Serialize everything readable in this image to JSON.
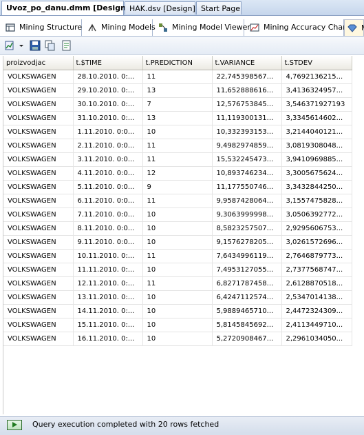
{
  "doc_tabs": [
    {
      "label": "Uvoz_po_danu.dmm [Design]",
      "active": true
    },
    {
      "label": "HAK.dsv [Design]",
      "active": false
    },
    {
      "label": "Start Page",
      "active": false
    }
  ],
  "designer_tabs": [
    {
      "label": "Mining Structure",
      "icon": "mining-structure-icon"
    },
    {
      "label": "Mining Models",
      "icon": "mining-models-icon"
    },
    {
      "label": "Mining Model Viewer",
      "icon": "model-viewer-icon"
    },
    {
      "label": "Mining Accuracy Chart",
      "icon": "accuracy-chart-icon"
    },
    {
      "label": "M",
      "icon": "prediction-query-icon"
    }
  ],
  "toolbar": {
    "buttons": [
      "design-mode-icon",
      "save-icon",
      "copy-icon",
      "export-icon"
    ]
  },
  "grid": {
    "columns": [
      "proizvodjac",
      "t.$TIME",
      "t.PREDICTION",
      "t.VARIANCE",
      "t.STDEV"
    ],
    "rows": [
      [
        "VOLKSWAGEN",
        "28.10.2010. 0:...",
        "11",
        "22,745398567...",
        "4,7692136215..."
      ],
      [
        "VOLKSWAGEN",
        "29.10.2010. 0:...",
        "13",
        "11,652888616...",
        "3,4136324957..."
      ],
      [
        "VOLKSWAGEN",
        "30.10.2010. 0:...",
        "7",
        "12,576753845...",
        "3,546371927193"
      ],
      [
        "VOLKSWAGEN",
        "31.10.2010. 0:...",
        "13",
        "11,119300131...",
        "3,3345614602..."
      ],
      [
        "VOLKSWAGEN",
        "1.11.2010. 0:0...",
        "10",
        "10,332393153...",
        "3,2144040121..."
      ],
      [
        "VOLKSWAGEN",
        "2.11.2010. 0:0...",
        "11",
        "9,4982974859...",
        "3,0819308048..."
      ],
      [
        "VOLKSWAGEN",
        "3.11.2010. 0:0...",
        "11",
        "15,532245473...",
        "3,9410969885..."
      ],
      [
        "VOLKSWAGEN",
        "4.11.2010. 0:0...",
        "12",
        "10,893746234...",
        "3,3005675624..."
      ],
      [
        "VOLKSWAGEN",
        "5.11.2010. 0:0...",
        "9",
        "11,177550746...",
        "3,3432844250..."
      ],
      [
        "VOLKSWAGEN",
        "6.11.2010. 0:0...",
        "11",
        "9,9587428064...",
        "3,1557475828..."
      ],
      [
        "VOLKSWAGEN",
        "7.11.2010. 0:0...",
        "10",
        "9,3063999998...",
        "3,0506392772..."
      ],
      [
        "VOLKSWAGEN",
        "8.11.2010. 0:0...",
        "10",
        "8,5823257507...",
        "2,9295606753..."
      ],
      [
        "VOLKSWAGEN",
        "9.11.2010. 0:0...",
        "10",
        "9,1576278205...",
        "3,0261572696..."
      ],
      [
        "VOLKSWAGEN",
        "10.11.2010. 0:...",
        "11",
        "7,6434996119...",
        "2,7646879773..."
      ],
      [
        "VOLKSWAGEN",
        "11.11.2010. 0:...",
        "10",
        "7,4953127055...",
        "2,7377568747..."
      ],
      [
        "VOLKSWAGEN",
        "12.11.2010. 0:...",
        "11",
        "6,8271787458...",
        "2,6128870518..."
      ],
      [
        "VOLKSWAGEN",
        "13.11.2010. 0:...",
        "10",
        "6,4247112574...",
        "2,5347014138..."
      ],
      [
        "VOLKSWAGEN",
        "14.11.2010. 0:...",
        "10",
        "5,9889465710...",
        "2,4472324309..."
      ],
      [
        "VOLKSWAGEN",
        "15.11.2010. 0:...",
        "10",
        "5,8145845692...",
        "2,4113449710..."
      ],
      [
        "VOLKSWAGEN",
        "16.11.2010. 0:...",
        "10",
        "5,2720908467...",
        "2,2961034050..."
      ]
    ]
  },
  "status": {
    "text": "Query execution completed with 20 rows fetched",
    "icon": "query-complete-icon"
  }
}
